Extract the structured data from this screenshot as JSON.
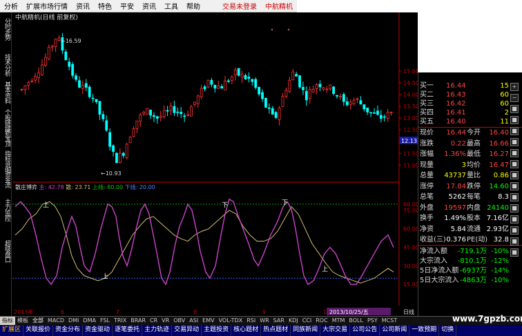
{
  "menu": {
    "items": [
      "分析",
      "扩展市场行情",
      "资讯",
      "特色",
      "平安",
      "资讯",
      "工具",
      "帮助"
    ],
    "warning": "交易未登录",
    "stock_title": "中航精机"
  },
  "left_tabs": [
    "分时走势",
    "技术分析",
    "基本资料",
    "个股链接",
    "新宝顶",
    "指标说明",
    "资金流",
    "主力监控",
    "超级盘口"
  ],
  "chart": {
    "title": "中航精机(日线 前复权)",
    "high_label": "16.59",
    "low_label": "10.93",
    "price_axis": [
      "15.00",
      "14.50",
      "14.00",
      "13.50",
      "13.00",
      "12.50",
      "12.00",
      "11.50",
      "11.00"
    ],
    "current_price_tag": "12.13",
    "indicator_name": "散庄博弈",
    "indicator_values": {
      "main_label": "主",
      "main": "42.78",
      "scatter_label": "散",
      "scatter": "23.71",
      "upper_label": "上线",
      "upper": "80.00",
      "lower_label": "下线",
      "lower": "20.00"
    },
    "ind_axis": [
      "80.00",
      "75.00",
      "60.00",
      "45.00",
      "30.00",
      "15.00"
    ],
    "date_labels": [
      "2013年",
      "6",
      "7",
      "8",
      "9",
      "10",
      "11"
    ],
    "cursor_date": "2013/10/25/五",
    "period_label": "日线"
  },
  "chart_data": {
    "type": "candlestick",
    "series": [
      {
        "name": "主",
        "color": "#cc44cc"
      },
      {
        "name": "散",
        "color": "#d4c070"
      }
    ],
    "upper_line": 80,
    "lower_line": 20
  },
  "quote": {
    "bids": [
      {
        "label": "买一",
        "price": "16.44",
        "vol": "15"
      },
      {
        "label": "买二",
        "price": "16.43",
        "vol": "60"
      },
      {
        "label": "买三",
        "price": "16.42",
        "vol": "60"
      },
      {
        "label": "买四",
        "price": "16.41",
        "vol": "2"
      },
      {
        "label": "买五",
        "price": "16.40",
        "vol": "11"
      }
    ],
    "rows": [
      {
        "l1": "现价",
        "v1": "16.44",
        "l2": "今开",
        "v2": "16.40",
        "c1": "#ff4444",
        "c2": "#ff4444"
      },
      {
        "l1": "涨跌",
        "v1": "0.22",
        "l2": "最高",
        "v2": "16.66",
        "c1": "#ff4444",
        "c2": "#ff4444"
      },
      {
        "l1": "涨幅",
        "v1": "1.36%",
        "l2": "最低",
        "v2": "16.27",
        "c1": "#ff4444",
        "c2": "#ff4444"
      },
      {
        "l1": "现量",
        "v1": "3",
        "l2": "均价",
        "v2": "16.47",
        "c1": "#ffff00",
        "c2": "#ff4444"
      },
      {
        "l1": "总量",
        "v1": "43737",
        "l2": "量比",
        "v2": "0.86",
        "c1": "#ffff00",
        "c2": "#ffff00"
      },
      {
        "l1": "涨停",
        "v1": "17.84",
        "l2": "跌停",
        "v2": "14.60",
        "c1": "#ff4444",
        "c2": "#00ff00"
      },
      {
        "l1": "总笔",
        "v1": "5262",
        "l2": "每笔",
        "v2": "8.3",
        "c1": "#ffffff",
        "c2": "#ffffff"
      },
      {
        "l1": "外盘",
        "v1": "19597",
        "l2": "内盘",
        "v2": "24140",
        "c1": "#ff4444",
        "c2": "#00ff00"
      },
      {
        "l1": "换手",
        "v1": "1.49%",
        "l2": "股本",
        "v2": "7.16亿",
        "c1": "#ffffff",
        "c2": "#ffffff"
      },
      {
        "l1": "净资",
        "v1": "5.84",
        "l2": "流通",
        "v2": "2.93亿",
        "c1": "#ffffff",
        "c2": "#ffffff"
      },
      {
        "l1": "收益(三)",
        "v1": "0.376",
        "l2": "PE(动)",
        "v2": "32.8",
        "c1": "#ffffff",
        "c2": "#ffffff"
      }
    ],
    "flows": [
      {
        "label": "净流入额",
        "value": "-719.1万",
        "pct": "-10%"
      },
      {
        "label": "大宗流入",
        "value": "-810.1万",
        "pct": "-12%"
      },
      {
        "label": "5日净流入额",
        "value": "-6937万",
        "pct": "-14%"
      },
      {
        "label": "5日大宗流入",
        "value": "-4863万",
        "pct": "-10%"
      }
    ]
  },
  "indicator_tabs": [
    "指标",
    "模板",
    "全部",
    "MACD",
    "DMI",
    "DMA",
    "FSL",
    "TRIX",
    "BRAR",
    "CR",
    "VR",
    "OBV",
    "ASI",
    "EMV",
    "VOL-TDX",
    "RSI",
    "WR",
    "SAR",
    "KDJ",
    "CCI",
    "ROC",
    "MTM",
    "BOLL",
    "PSY",
    "MCST"
  ],
  "bottom_tabs": [
    "扩展区",
    "关联报价",
    "资金分布",
    "资金驱动",
    "逐笔委托",
    "主力轨迹",
    "交易异动",
    "主题投资",
    "核心题材",
    "热点题材",
    "同族新闻",
    "大宗交易",
    "公司公告",
    "公司新闻",
    "一致预期",
    "切换"
  ],
  "watermark": "www.7gpzb.com"
}
